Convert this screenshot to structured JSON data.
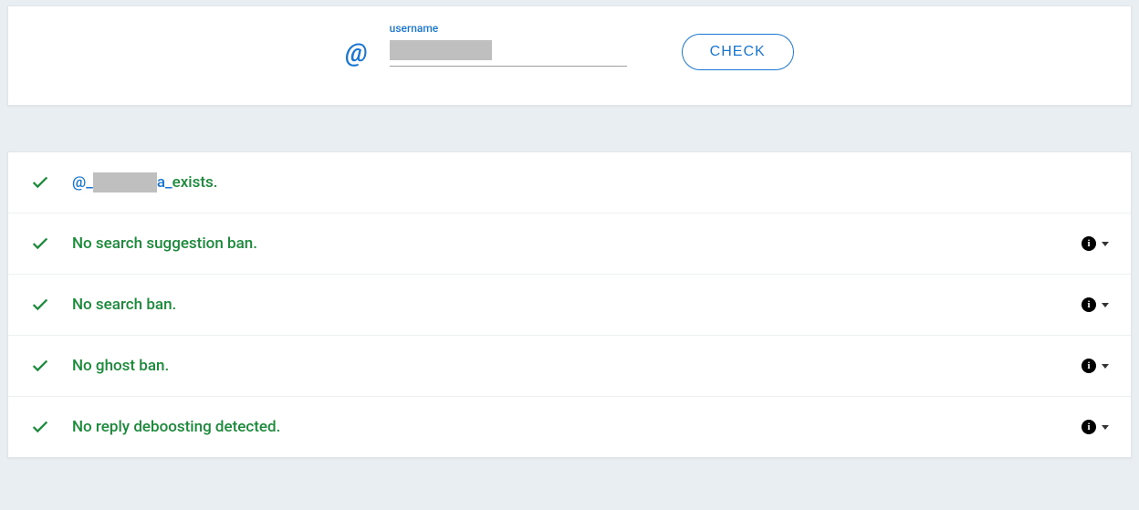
{
  "form": {
    "label": "username",
    "at": "@",
    "input_value": "",
    "check_button": "CHECK"
  },
  "results": {
    "exists": {
      "prefix": "@_",
      "suffix": "a_",
      "tail": " exists."
    },
    "rows": [
      {
        "text": "No search suggestion ban."
      },
      {
        "text": "No search ban."
      },
      {
        "text": "No ghost ban."
      },
      {
        "text": "No reply deboosting detected."
      }
    ]
  },
  "icons": {
    "info_glyph": "i"
  }
}
